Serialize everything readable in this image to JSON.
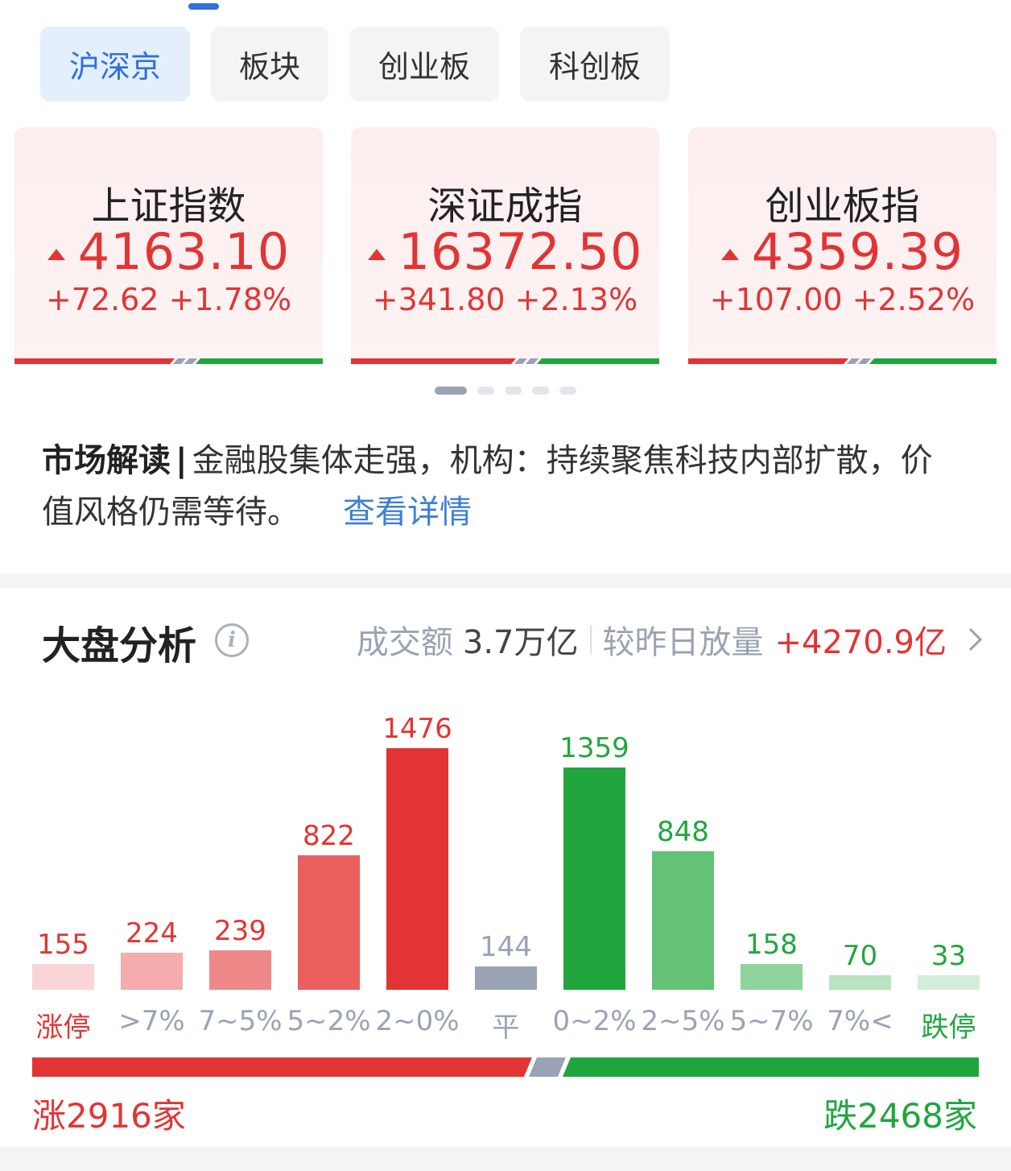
{
  "tabs": [
    {
      "label": "沪深京",
      "active": true
    },
    {
      "label": "板块",
      "active": false
    },
    {
      "label": "创业板",
      "active": false
    },
    {
      "label": "科创板",
      "active": false
    }
  ],
  "index_cards": [
    {
      "name": "上证指数",
      "value": "4163.10",
      "change": "+72.62 +1.78%",
      "direction": "up"
    },
    {
      "name": "深证成指",
      "value": "16372.50",
      "change": "+341.80 +2.13%",
      "direction": "up"
    },
    {
      "name": "创业板指",
      "value": "4359.39",
      "change": "+107.00 +2.52%",
      "direction": "up"
    }
  ],
  "carousel": {
    "pages": 5,
    "active": 0
  },
  "market_reading": {
    "label": "市场解读",
    "separator": "|",
    "text": "金融股集体走强，机构：持续聚焦科技内部扩散，价值风格仍需等待。",
    "link": "查看详情"
  },
  "analysis": {
    "title": "大盘分析",
    "info_icon": "info-icon",
    "turnover_label": "成交额",
    "turnover_value": "3.7万亿",
    "compare_label": "较昨日放量",
    "compare_value": "+4270.9亿"
  },
  "colors": {
    "up": "#e23434",
    "down": "#21a63f",
    "flat": "#9aa3b4",
    "accent": "#2f6fde"
  },
  "chart_data": {
    "type": "bar",
    "categories": [
      "涨停",
      ">7%",
      "7~5%",
      "5~2%",
      "2~0%",
      "平",
      "0~2%",
      "2~5%",
      "5~7%",
      "7%<",
      "跌停"
    ],
    "values": [
      155,
      224,
      239,
      822,
      1476,
      144,
      1359,
      848,
      158,
      70,
      33
    ],
    "bar_colors": [
      "#fad5d5",
      "#f4acac",
      "#ef8888",
      "#eb5e5e",
      "#e23434",
      "#9aa3b4",
      "#21a63f",
      "#63c276",
      "#8ed49c",
      "#b9e4c1",
      "#d3eed8"
    ],
    "label_colors": [
      "#e23434",
      "#e23434",
      "#e23434",
      "#e23434",
      "#e23434",
      "#9aa3b4",
      "#21a63f",
      "#21a63f",
      "#21a63f",
      "#21a63f",
      "#21a63f"
    ],
    "category_label_colors": [
      "#e23434",
      "#9aa3b4",
      "#9aa3b4",
      "#9aa3b4",
      "#9aa3b4",
      "#9aa3b4",
      "#9aa3b4",
      "#9aa3b4",
      "#9aa3b4",
      "#9aa3b4",
      "#21a63f"
    ],
    "ylim": [
      0,
      1476
    ]
  },
  "breadth": {
    "rise_label": "涨2916家",
    "fall_label": "跌2468家",
    "rise": 2916,
    "fall": 2468
  }
}
